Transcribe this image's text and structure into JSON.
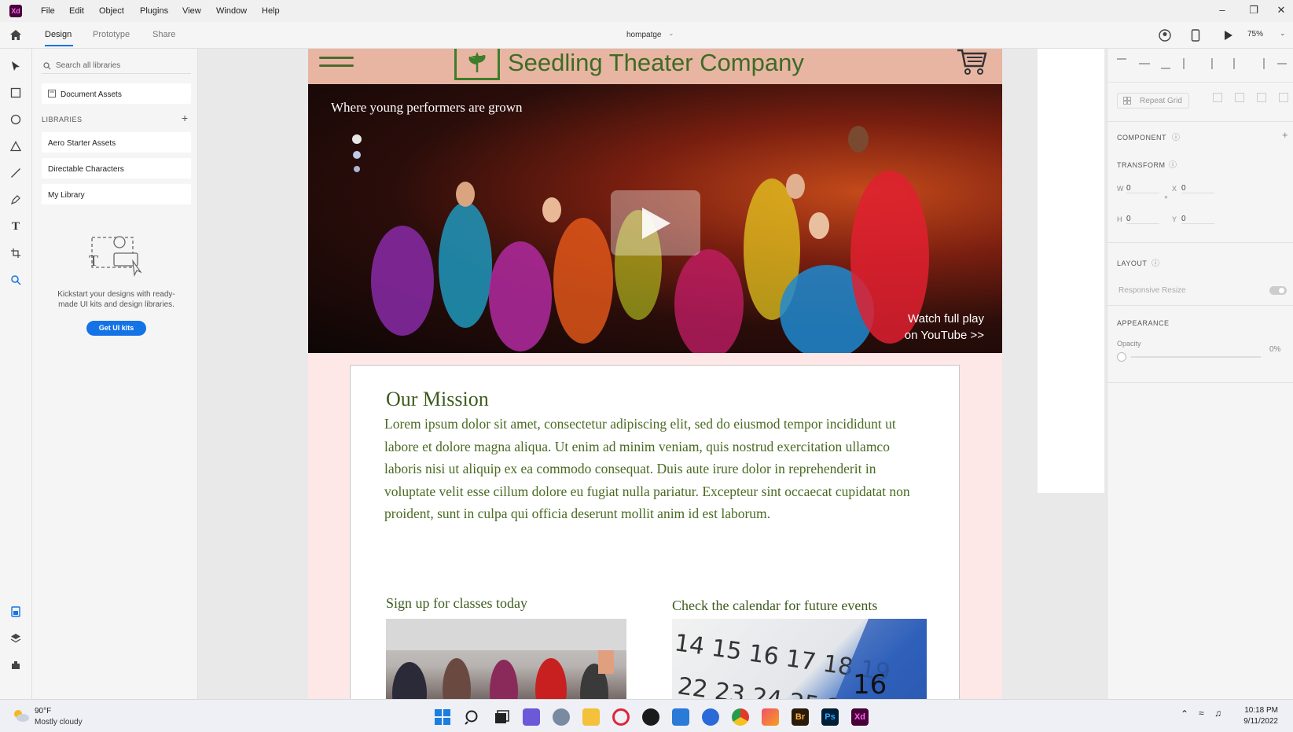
{
  "app": {
    "logo_text": "Xd",
    "menu": [
      "File",
      "Edit",
      "Object",
      "Plugins",
      "View",
      "Window",
      "Help"
    ]
  },
  "toolbar": {
    "tabs": [
      "Design",
      "Prototype",
      "Share"
    ],
    "document_name": "hompatge",
    "zoom": "75%"
  },
  "libraries": {
    "search_placeholder": "Search all libraries",
    "document_assets": "Document Assets",
    "heading": "LIBRARIES",
    "items": [
      "Aero Starter Assets",
      "Directable Characters",
      "My Library"
    ],
    "description": "Kickstart your designs with ready-made UI kits and design libraries.",
    "cta": "Get UI kits"
  },
  "site": {
    "title": "Seedling Theater Company",
    "hero_tagline": "Where young performers are grown",
    "hero_cta_line1": "Watch full play",
    "hero_cta_line2": "on YouTube >>",
    "mission_title": "Our Mission",
    "mission_body": "Lorem ipsum dolor sit amet, consectetur adipiscing elit, sed do eiusmod tempor incididunt ut labore et dolore magna aliqua. Ut enim ad minim veniam, quis nostrud exercitation ullamco laboris nisi ut aliquip ex ea commodo consequat. Duis aute irure dolor in reprehenderit in voluptate velit esse cillum dolore eu fugiat nulla pariatur. Excepteur sint occaecat cupidatat non proident, sunt in culpa qui officia deserunt mollit anim id est laborum.",
    "classes_title": "Sign up for classes today",
    "calendar_title": "Check the calendar for future events"
  },
  "properties": {
    "repeat_grid": "Repeat Grid",
    "component": "COMPONENT",
    "transform": "TRANSFORM",
    "w_label": "W",
    "w_value": "0",
    "x_label": "X",
    "x_value": "0",
    "h_label": "H",
    "h_value": "0",
    "y_label": "Y",
    "y_value": "0",
    "layout": "LAYOUT",
    "responsive_resize": "Responsive Resize",
    "appearance": "APPEARANCE",
    "opacity_label": "Opacity",
    "opacity_value": "0%"
  },
  "taskbar": {
    "weather_temp": "90°F",
    "weather_desc": "Mostly cloudy",
    "time": "10:18 PM",
    "date": "9/11/2022"
  },
  "colors": {
    "accent": "#1473e6",
    "site_header": "#e8b5a3",
    "site_green": "#3e6b25",
    "artboard_bg": "#fde7e7"
  }
}
